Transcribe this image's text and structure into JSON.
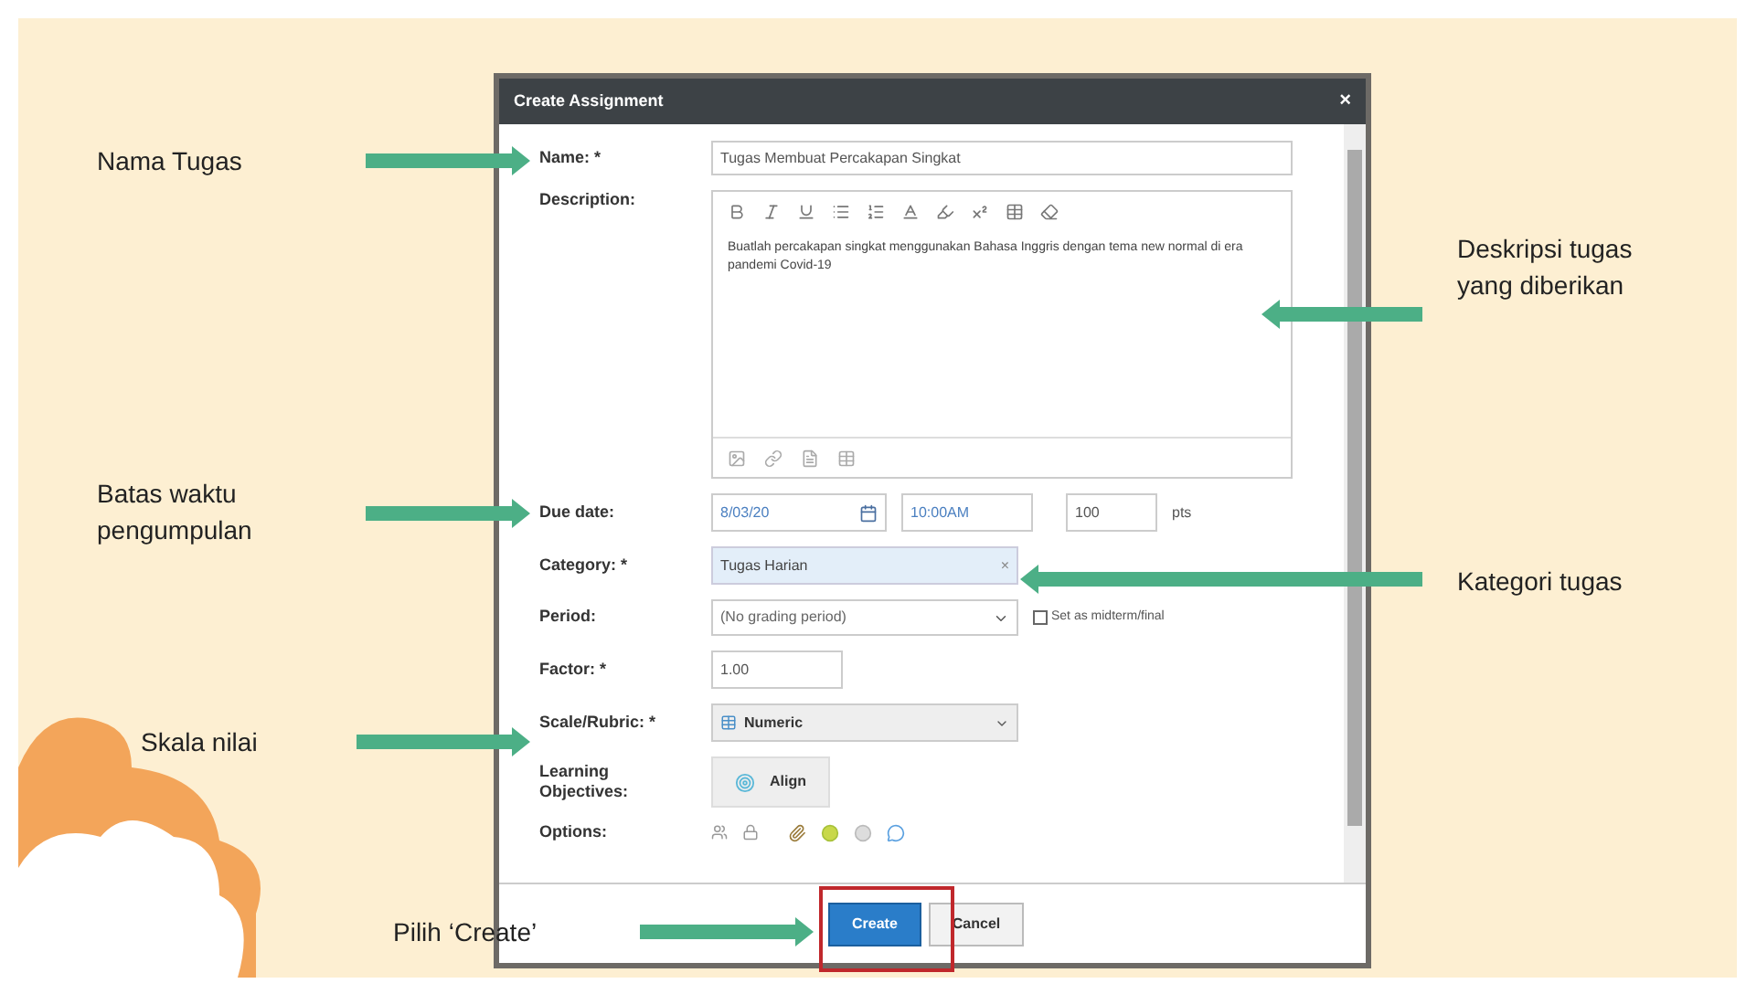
{
  "dialog": {
    "title": "Create Assignment",
    "close": "×",
    "name": {
      "label": "Name: *",
      "value": "Tugas Membuat Percakapan Singkat"
    },
    "description": {
      "label": "Description:",
      "value": "Buatlah percakapan singkat menggunakan Bahasa Inggris dengan tema new normal di era pandemi Covid-19"
    },
    "due_date": {
      "label": "Due date:",
      "date": "8/03/20",
      "time": "10:00AM",
      "points": "100",
      "points_unit": "pts"
    },
    "category": {
      "label": "Category: *",
      "value": "Tugas Harian",
      "remove": "×"
    },
    "period": {
      "label": "Period:",
      "value": "(No grading period)",
      "midterm": {
        "label": "Set as midterm/final",
        "checked": false
      }
    },
    "factor": {
      "label": "Factor: *",
      "value": "1.00"
    },
    "scale": {
      "label": "Scale/Rubric: *",
      "value": "Numeric"
    },
    "objectives": {
      "label": "Learning Objectives:",
      "button": "Align"
    },
    "options": {
      "label": "Options:"
    },
    "buttons": [
      {
        "label": "Create",
        "kind": "primary"
      },
      {
        "label": "Cancel",
        "kind": "secondary"
      }
    ]
  },
  "annotations": [
    {
      "text": "Nama Tugas"
    },
    {
      "text": "Deskripsi tugas yang diberikan"
    },
    {
      "text": "Batas waktu pengumpulan"
    },
    {
      "text": "Kategori tugas"
    },
    {
      "text": "Skala nilai"
    },
    {
      "text": "Pilih ‘Create’"
    }
  ]
}
